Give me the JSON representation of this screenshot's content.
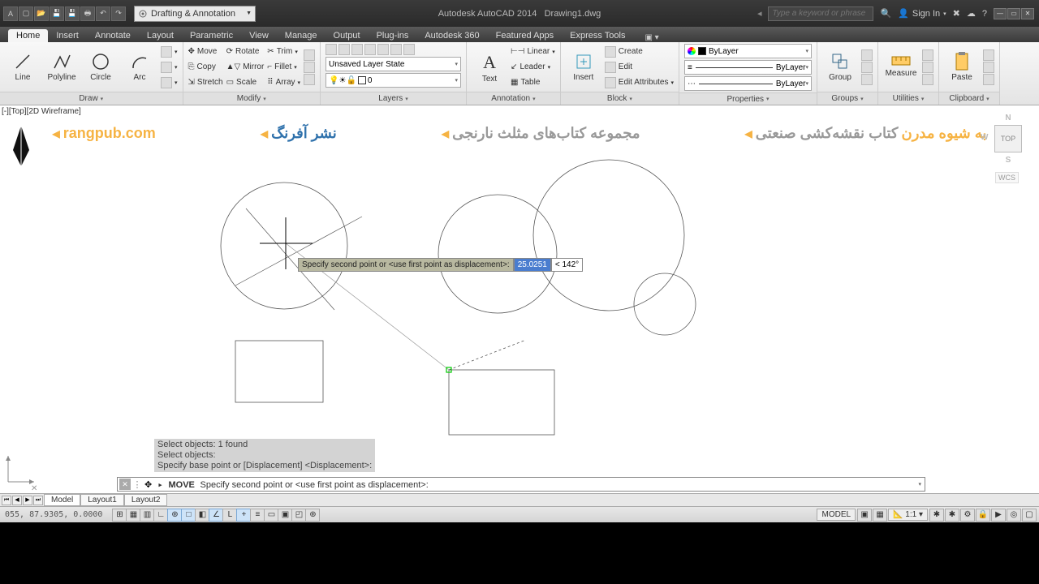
{
  "title": {
    "app": "Autodesk AutoCAD 2014",
    "doc": "Drawing1.dwg"
  },
  "workspace": "Drafting & Annotation",
  "search_placeholder": "Type a keyword or phrase",
  "signin": "Sign In",
  "tabs": [
    "Home",
    "Insert",
    "Annotate",
    "Layout",
    "Parametric",
    "View",
    "Manage",
    "Output",
    "Plug-ins",
    "Autodesk 360",
    "Featured Apps",
    "Express Tools"
  ],
  "active_tab": 0,
  "panels": {
    "draw": {
      "title": "Draw",
      "items": [
        "Line",
        "Polyline",
        "Circle",
        "Arc"
      ]
    },
    "modify": {
      "title": "Modify",
      "r1": [
        "Move",
        "Rotate",
        "Trim"
      ],
      "r2": [
        "Copy",
        "Mirror",
        "Fillet"
      ],
      "r3": [
        "Stretch",
        "Scale",
        "Array"
      ]
    },
    "layers": {
      "title": "Layers",
      "state": "Unsaved Layer State",
      "current": "0"
    },
    "annotation": {
      "title": "Annotation",
      "text": "Text",
      "items": [
        "Linear",
        "Leader",
        "Table"
      ]
    },
    "block": {
      "title": "Block",
      "insert": "Insert",
      "items": [
        "Create",
        "Edit",
        "Edit Attributes"
      ]
    },
    "properties": {
      "title": "Properties",
      "layer": "ByLayer",
      "lt": "ByLayer",
      "lw": "ByLayer"
    },
    "groups": {
      "title": "Groups",
      "group": "Group"
    },
    "utilities": {
      "title": "Utilities",
      "measure": "Measure"
    },
    "clipboard": {
      "title": "Clipboard",
      "paste": "Paste"
    }
  },
  "viewport_label": "[-][Top][2D Wireframe]",
  "viewcube": {
    "top": "TOP",
    "n": "N",
    "w": "W",
    "s": "S",
    "wcs": "WCS"
  },
  "dynamic_input": {
    "prompt": "Specify second point or <use first point as displacement>:",
    "dist": "25.0251",
    "angle_prefix": "<",
    "angle": "142°"
  },
  "cmd_history": [
    "Select objects: 1 found",
    "Select objects:",
    "Specify base point or [Displacement] <Displacement>:"
  ],
  "cmdline": {
    "cmd": "MOVE",
    "rest": "Specify second point or <use first point as displacement>:"
  },
  "model_tabs": [
    "Model",
    "Layout1",
    "Layout2"
  ],
  "status": {
    "coords": "055, 87.9305, 0.0000",
    "model": "MODEL",
    "scale": "1:1"
  },
  "watermarks": {
    "w1": "rangpub.com",
    "w2": "نشر آفرنگ",
    "w3": "مجموعه کتاب‌های مثلث نارنجی",
    "w4_a": "کتاب نقشه‌کشی صنعتی",
    "w4_b": "به شیوه مدرن"
  }
}
